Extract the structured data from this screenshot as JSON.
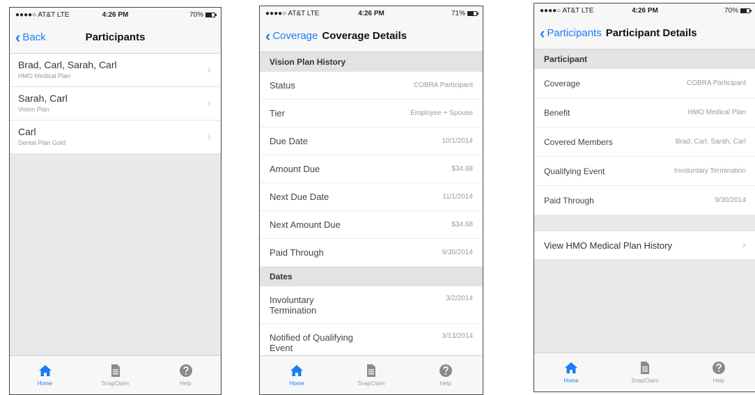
{
  "status_bar": [
    {
      "carrier": "●●●●○ AT&T  LTE",
      "time": "4:26 PM",
      "battery": "70%"
    },
    {
      "carrier": "●●●●○ AT&T  LTE",
      "time": "4:26 PM",
      "battery": "71%"
    },
    {
      "carrier": "●●●●○ AT&T  LTE",
      "time": "4:26 PM",
      "battery": "70%"
    }
  ],
  "screen1": {
    "back_label": "Back",
    "title": "Participants",
    "items": [
      {
        "title": "Brad, Carl, Sarah, Carl",
        "subtitle": "HMO Medical Plan"
      },
      {
        "title": "Sarah, Carl",
        "subtitle": "Vision Plan"
      },
      {
        "title": "Carl",
        "subtitle": "Dental Plan Gold"
      }
    ]
  },
  "screen2": {
    "back_label": "Coverage",
    "title": "Coverage Details",
    "section1": "Vision Plan History",
    "rows": [
      {
        "label": "Status",
        "value": "COBRA Participant"
      },
      {
        "label": "Tier",
        "value": "Employee + Spouse"
      },
      {
        "label": "Due Date",
        "value": "10/1/2014"
      },
      {
        "label": "Amount Due",
        "value": "$34.68"
      },
      {
        "label": "Next Due Date",
        "value": "11/1/2014"
      },
      {
        "label": "Next Amount Due",
        "value": "$34.68"
      },
      {
        "label": "Paid Through",
        "value": "9/30/2014"
      }
    ],
    "section2": "Dates",
    "date_rows": [
      {
        "label": "Involuntary Termination",
        "value": "3/2/2014"
      },
      {
        "label": "Notified of Qualifying Event",
        "value": "3/13/2014"
      }
    ]
  },
  "screen3": {
    "back_label": "Participants",
    "title": "Participant Details",
    "section": "Participant",
    "rows": [
      {
        "label": "Coverage",
        "value": "COBRA Participant"
      },
      {
        "label": "Benefit",
        "value": "HMO Medical Plan"
      },
      {
        "label": "Covered Members",
        "value": "Brad, Carl, Sarah, Carl"
      },
      {
        "label": "Qualifying Event",
        "value": "Involuntary Termination"
      },
      {
        "label": "Paid Through",
        "value": "9/30/2014"
      }
    ],
    "history_link": "View HMO Medical Plan History"
  },
  "tabs": [
    {
      "label": "Home",
      "icon": "home-icon"
    },
    {
      "label": "SnapClaim",
      "icon": "document-icon"
    },
    {
      "label": "Help",
      "icon": "help-icon"
    }
  ],
  "colors": {
    "accent": "#1e7cf6",
    "inactive": "#8a8a8a"
  }
}
